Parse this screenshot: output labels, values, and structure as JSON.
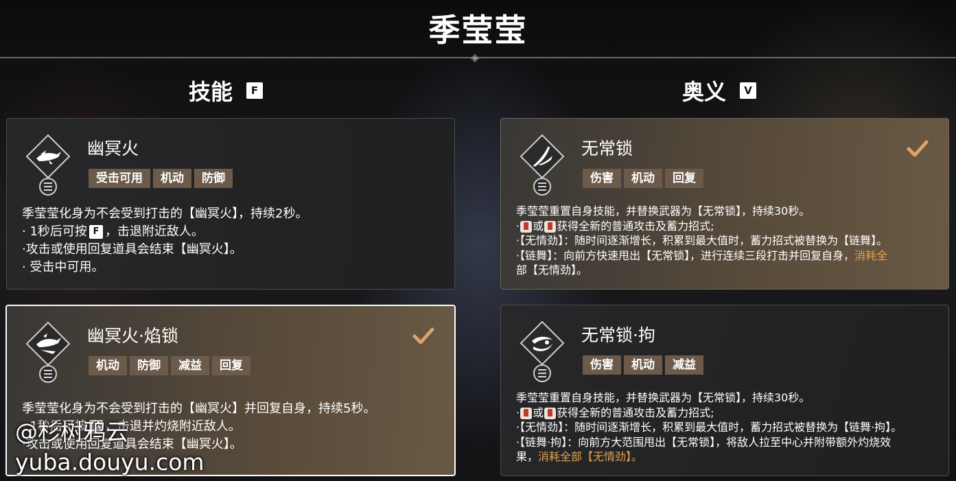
{
  "header": {
    "title": "季莹莹"
  },
  "columns": {
    "skill": {
      "title": "技能",
      "key": "F"
    },
    "ultimate": {
      "title": "奥义",
      "key": "V"
    }
  },
  "cards": {
    "skill1": {
      "name": "幽冥火",
      "icon": "ghost-dash-icon",
      "selected": false,
      "tags": [
        "受击可用",
        "机动",
        "防御"
      ],
      "desc": [
        "季莹莹化身为不会受到打击的【幽冥火】，持续2秒。",
        "· 1秒后可按",
        "，击退附近敌人。",
        "·攻击或使用回复道具会结束【幽冥火】。",
        "· 受击中可用。"
      ]
    },
    "skill2": {
      "name": "幽冥火·焰锁",
      "icon": "ghost-dash-chain-icon",
      "selected": true,
      "tags": [
        "机动",
        "防御",
        "减益",
        "回复"
      ],
      "desc": [
        "季莹莹化身为不会受到打击的【幽冥火】并回复自身，持续5秒。",
        "· 1秒后可按",
        "，击退并灼烧附近敌人。",
        "·攻击或使用回复道具会结束【幽冥火】。"
      ]
    },
    "ult1": {
      "name": "无常锁",
      "icon": "blade-icon",
      "selected": true,
      "tags": [
        "伤害",
        "机动",
        "回复"
      ],
      "desc": [
        "季莹莹重置自身技能，并替换武器为【无常锁】，持续30秒。",
        "·",
        "或",
        "获得全新的普通攻击及蓄力招式;",
        "·【无情劲】：随时间逐渐增长，积累到最大值时，蓄力招式被替换为【链舞】。",
        "·【链舞】：向前方快速甩出【无常锁】，进行连续三段打击并回复自身，",
        "消耗全",
        "部【无情劲】。"
      ]
    },
    "ult2": {
      "name": "无常锁·拘",
      "icon": "chain-sickle-icon",
      "selected": false,
      "tags": [
        "伤害",
        "机动",
        "减益"
      ],
      "desc": [
        "季莹莹重置自身技能，并替换武器为【无常锁】，持续30秒。",
        "·",
        "或",
        "获得全新的普通攻击及蓄力招式;",
        "·【无情劲】：随时间逐渐增长，积累到最大值时，蓄力招式被替换为【链舞·拘】。",
        "·【链舞·拘】：向前方大范围甩出【无常锁】，将敌人拉至中心并附带额外灼烧效",
        "果，",
        "消耗全部【无情劲】。"
      ]
    }
  },
  "watermark": {
    "line1": "@杉树鸦云",
    "line2": "yuba.douyu.com"
  },
  "colors": {
    "accent": "#e0a14e",
    "tag_bg": "#6c5b4b",
    "check": "#e0a366"
  }
}
